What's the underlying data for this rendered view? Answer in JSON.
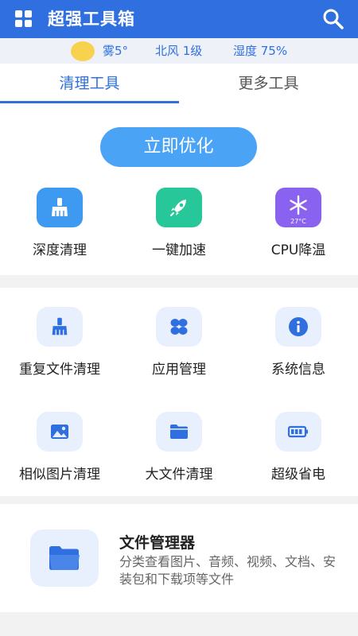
{
  "header": {
    "title": "超强工具箱",
    "menu_icon": "grid-menu-icon",
    "search_icon": "search-icon",
    "accent_color": "#2f6fe0"
  },
  "weather": {
    "icon": "sun-icon",
    "condition": "雾5°",
    "wind": "北风 1级",
    "humidity": "湿度 75%"
  },
  "tabs": [
    {
      "label": "清理工具",
      "active": true
    },
    {
      "label": "更多工具",
      "active": false
    }
  ],
  "main_action": {
    "label": "立即优化"
  },
  "quick_tools": [
    {
      "label": "深度清理",
      "icon": "broom-icon",
      "color": "#3d9af0"
    },
    {
      "label": "一键加速",
      "icon": "rocket-icon",
      "color": "#28c79a"
    },
    {
      "label": "CPU降温",
      "icon": "snowflake-icon",
      "color": "#8a62f0",
      "badge": "27°C"
    }
  ],
  "tools": [
    {
      "label": "重复文件清理",
      "icon": "broom-icon"
    },
    {
      "label": "应用管理",
      "icon": "apps-icon"
    },
    {
      "label": "系统信息",
      "icon": "info-icon"
    },
    {
      "label": "相似图片清理",
      "icon": "image-icon"
    },
    {
      "label": "大文件清理",
      "icon": "folder-icon"
    },
    {
      "label": "超级省电",
      "icon": "battery-icon"
    }
  ],
  "file_manager": {
    "title": "文件管理器",
    "description": "分类查看图片、音频、视频、文档、安装包和下载项等文件",
    "icon": "open-folder-icon"
  }
}
